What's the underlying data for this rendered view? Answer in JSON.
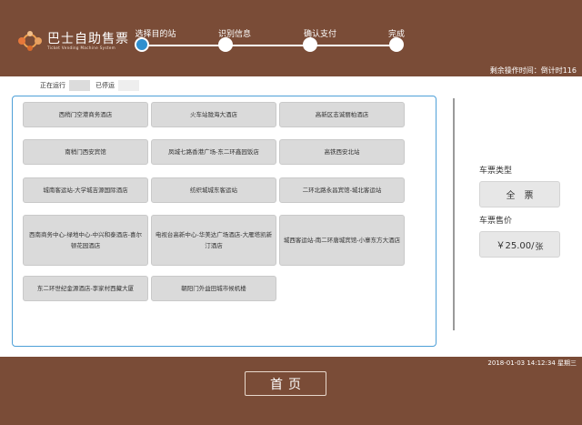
{
  "brand": {
    "name_cn": "巴士自助售票",
    "name_en": "Ticket Vending Machine System"
  },
  "steps": [
    {
      "label": "选择目的站",
      "active": true
    },
    {
      "label": "识别信息",
      "active": false
    },
    {
      "label": "确认支付",
      "active": false
    },
    {
      "label": "完成",
      "active": false
    }
  ],
  "remaining_time": "剩余操作时间：倒计时116",
  "legend": {
    "running": "正在运行",
    "stopped": "已停运"
  },
  "stations": [
    "西稍门空港商务酒店",
    "火车站陇海大酒店",
    "高新区志诚丽柏酒店",
    "南稍门西安宾馆",
    "凤城七路香港广场-东二环鑫园饭店",
    "高铁西安北站",
    "城南客运站-大学城吉源国际酒店",
    "纺织城城东客运站",
    "二环北路永昌宾馆-城北客运站",
    "西南商务中心-绿地中心-中兴和泰酒店-喜尔顿花园酒店",
    "电视台高新中心-华美达广场酒店-大雁塔凯新汀酒店",
    "城西客运站-南二环唐城宾馆-小寨东方大酒店",
    "东二环世纪金源酒店-李家村西藏大厦",
    "朝阳门外益田城市候机楼"
  ],
  "ticket": {
    "type_label": "车票类型",
    "type_value": "全　票",
    "price_label": "车票售价",
    "price_value": "￥25.00/",
    "price_unit": "张"
  },
  "datetime": "2018-01-03 14:12:34 星期三",
  "home_button": "首页",
  "colors": {
    "header_bg": "#7a4c37",
    "active_step": "#2f8fce",
    "panel_border": "#4ea0d8"
  }
}
